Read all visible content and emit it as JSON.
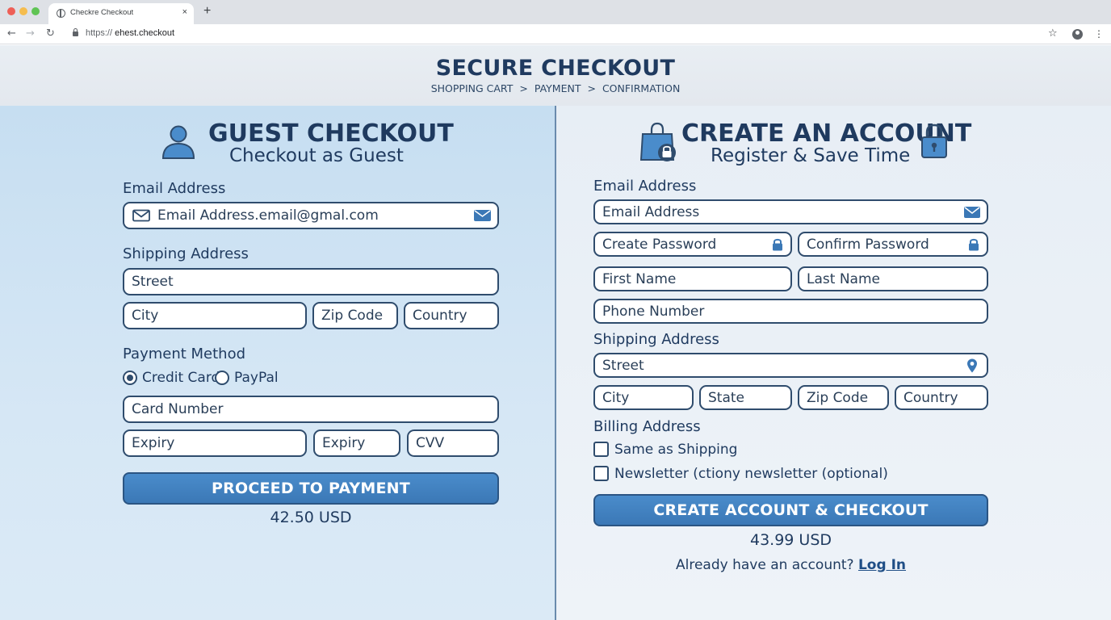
{
  "browser": {
    "tab_title": "Checkre Checkout",
    "tab_close": "×",
    "new_tab": "+",
    "url_scheme": "https://",
    "url_host": "ehest.checkout"
  },
  "header": {
    "title": "SECURE CHECKOUT",
    "breadcrumb": [
      "SHOPPING CART",
      "PAYMENT",
      "CONFIRMATION"
    ],
    "separator": ">"
  },
  "guest": {
    "title": "GUEST CHECKOUT",
    "subtitle": "Checkout as Guest",
    "email_label": "Email Address",
    "email_value": "Email Address.email@gmal.com",
    "shipping_label": "Shipping Address",
    "street": "Street",
    "city": "City",
    "zip": "Zip Code",
    "country": "Country",
    "payment_label": "Payment Method",
    "payment_options": [
      "Credit Card",
      "PayPal"
    ],
    "payment_selected": "Credit Card",
    "card_number": "Card Number",
    "expiry1": "Expiry",
    "expiry2": "Expiry",
    "cvv": "CVV",
    "button": "PROCEED TO PAYMENT",
    "price": "42.50 USD"
  },
  "account": {
    "title": "CREATE AN ACCOUNT",
    "subtitle": "Register & Save Time",
    "email_label": "Email Address",
    "email": "Email Address",
    "create_password": "Create Password",
    "confirm_password": "Confirm Password",
    "first_name": "First Name",
    "last_name": "Last Name",
    "phone": "Phone Number",
    "shipping_label": "Shipping Address",
    "street": "Street",
    "city": "City",
    "state": "State",
    "zip": "Zip Code",
    "country": "Country",
    "billing_label": "Billing Address",
    "same_as_shipping": "Same as Shipping",
    "newsletter": "Newsletter (ctiony newsletter (optional)",
    "button": "CREATE ACCOUNT & CHECKOUT",
    "price": "43.99 USD",
    "login_prompt": "Already have an account?",
    "login_link": "Log In"
  },
  "colors": {
    "accent": "#3b78b6",
    "text": "#1f3a5f",
    "left_panel": "#c6def1",
    "right_panel": "#eef3f8"
  },
  "icons": [
    "user-icon",
    "shopping-bag-lock-icon",
    "padlock-icon",
    "mail-outline-icon",
    "mail-filled-icon",
    "lock-icon",
    "map-pin-icon"
  ]
}
